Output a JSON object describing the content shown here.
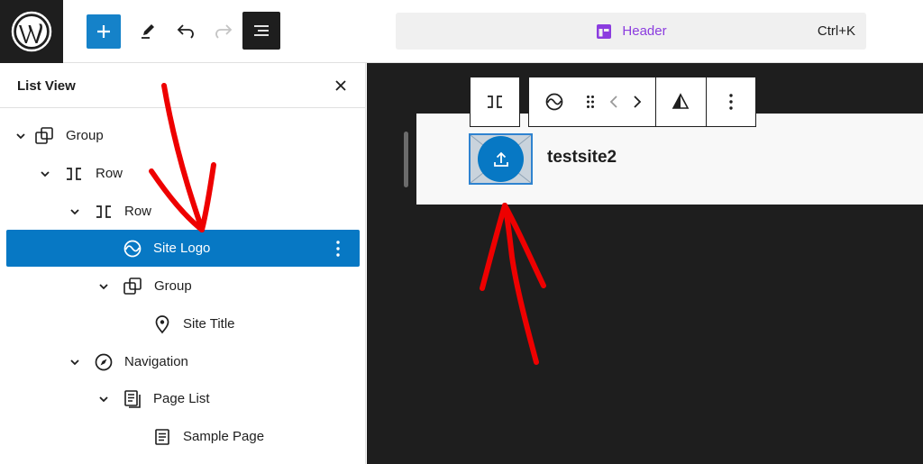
{
  "topbar": {
    "command_label": "Header",
    "command_shortcut": "Ctrl+K"
  },
  "sidebar": {
    "title": "List View",
    "items": [
      {
        "label": "Group",
        "icon": "group-icon",
        "chevron": true
      },
      {
        "label": "Row",
        "icon": "row-icon",
        "chevron": true
      },
      {
        "label": "Row",
        "icon": "row-icon",
        "chevron": true
      },
      {
        "label": "Site Logo",
        "icon": "site-logo-icon",
        "chevron": false,
        "selected": true
      },
      {
        "label": "Group",
        "icon": "group-icon",
        "chevron": true
      },
      {
        "label": "Site Title",
        "icon": "map-pin-icon",
        "chevron": false
      },
      {
        "label": "Navigation",
        "icon": "compass-icon",
        "chevron": true
      },
      {
        "label": "Page List",
        "icon": "pages-icon",
        "chevron": true
      },
      {
        "label": "Sample Page",
        "icon": "page-icon",
        "chevron": false
      }
    ]
  },
  "canvas": {
    "site_title": "testsite2"
  },
  "colors": {
    "accent": "#0778c4",
    "dark": "#1e1e1e",
    "annotation": "#ee0000",
    "template_part": "#8b3cdf"
  }
}
